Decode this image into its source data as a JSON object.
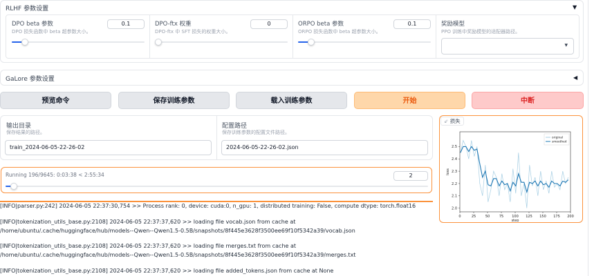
{
  "rlhf": {
    "title": "RLHF 参数设置",
    "caret": "▼",
    "dpo_beta": {
      "label": "DPO beta 参数",
      "desc": "DPO 损失函数中 beta 超参数大小。",
      "value": "0.1",
      "fraction": 0.1
    },
    "dpo_ftx": {
      "label": "DPO-ftx 权重",
      "desc": "DPO-ftx 中 SFT 损失的权重大小。",
      "value": "0",
      "fraction": 0.0
    },
    "orpo_beta": {
      "label": "ORPO beta 参数",
      "desc": "ORPO 损失函数中 beta 超参数大小。",
      "value": "0.1",
      "fraction": 0.1
    },
    "reward_model": {
      "label": "奖励模型",
      "desc": "PPO 训练中奖励模型的适配器路径。",
      "caret": "▾"
    }
  },
  "galore": {
    "title": "GaLore 参数设置",
    "caret": "◀"
  },
  "buttons": {
    "preview": "预览命令",
    "save": "保存训练参数",
    "load": "载入训练参数",
    "start": "开始",
    "abort": "中断"
  },
  "output_dir": {
    "label": "输出目录",
    "desc": "保存结果的路径。",
    "value": "train_2024-06-05-22-26-02"
  },
  "config_path": {
    "label": "配置路径",
    "desc": "保存训练参数的配置文件路径。",
    "value": "2024-06-05-22-26-02.json"
  },
  "progress": {
    "text": "Running 196/9645: 0:03:38 < 2:55:34",
    "value": "2",
    "fraction": 0.0203
  },
  "loss_panel": {
    "tab_icon": "⇙",
    "tab_label": "损失"
  },
  "logs": [
    "[INFO|parser.py:242] 2024-06-05 22:37:30,754 >> Process rank: 0, device: cuda:0, n_gpu: 1, distributed training: False, compute dtype: torch.float16",
    "[INFO|tokenization_utils_base.py:2108] 2024-06-05 22:37:37,620 >> loading file vocab.json from cache at /home/ubuntu/.cache/huggingface/hub/models--Qwen--Qwen1.5-0.5B/snapshots/8f445e3628f3500ee69f10f5342a39/vocab.json",
    "[INFO|tokenization_utils_base.py:2108] 2024-06-05 22:37:37,620 >> loading file merges.txt from cache at /home/ubuntu/.cache/huggingface/hub/models--Qwen--Qwen1.5-0.5B/snapshots/8f445e3628f3500ee69f10f5342a39/merges.txt",
    "[INFO|tokenization_utils_base.py:2108] 2024-06-05 22:37:37,620 >> loading file added_tokens.json from cache at None"
  ],
  "chart_data": {
    "type": "line",
    "xlabel": "step",
    "ylabel": "loss",
    "xlim": [
      0,
      200
    ],
    "ylim": [
      1.97,
      2.62
    ],
    "xticks": [
      "0",
      "25",
      "50",
      "75",
      "100",
      "125",
      "150",
      "175",
      "200"
    ],
    "yticks": [
      "2.0",
      "2.1",
      "2.2",
      "2.3",
      "2.4",
      "2.5"
    ],
    "legend_position": "top-right",
    "series": [
      {
        "name": "original",
        "color": "#a6cee3",
        "x": [
          1,
          6,
          11,
          16,
          21,
          26,
          31,
          36,
          41,
          46,
          51,
          56,
          61,
          66,
          71,
          76,
          81,
          86,
          91,
          96,
          101,
          106,
          111,
          116,
          121,
          126,
          131,
          136,
          141,
          146,
          151,
          156,
          161,
          166,
          171,
          176,
          181,
          186,
          191,
          196
        ],
        "y": [
          2.45,
          2.55,
          2.5,
          2.4,
          2.55,
          2.42,
          2.5,
          2.2,
          2.1,
          2.35,
          2.05,
          2.15,
          2.3,
          2.25,
          2.1,
          2.28,
          2.15,
          2.2,
          2.05,
          2.32,
          2.12,
          2.45,
          2.1,
          2.2,
          2.0,
          2.35,
          2.18,
          2.25,
          2.1,
          2.3,
          2.15,
          2.22,
          2.12,
          2.3,
          2.17,
          2.2,
          2.15,
          2.3,
          2.2,
          2.25
        ]
      },
      {
        "name": "smoothed",
        "color": "#1f78b4",
        "x": [
          1,
          6,
          11,
          16,
          21,
          26,
          31,
          36,
          41,
          46,
          51,
          56,
          61,
          66,
          71,
          76,
          81,
          86,
          91,
          96,
          101,
          106,
          111,
          116,
          121,
          126,
          131,
          136,
          141,
          146,
          151,
          156,
          161,
          166,
          171,
          176,
          181,
          186,
          191,
          196
        ],
        "y": [
          2.45,
          2.5,
          2.5,
          2.46,
          2.5,
          2.47,
          2.48,
          2.36,
          2.25,
          2.3,
          2.19,
          2.18,
          2.24,
          2.24,
          2.18,
          2.22,
          2.19,
          2.2,
          2.14,
          2.21,
          2.18,
          2.28,
          2.21,
          2.21,
          2.13,
          2.21,
          2.2,
          2.22,
          2.18,
          2.22,
          2.19,
          2.2,
          2.17,
          2.22,
          2.2,
          2.2,
          2.18,
          2.22,
          2.21,
          2.23
        ]
      }
    ]
  }
}
